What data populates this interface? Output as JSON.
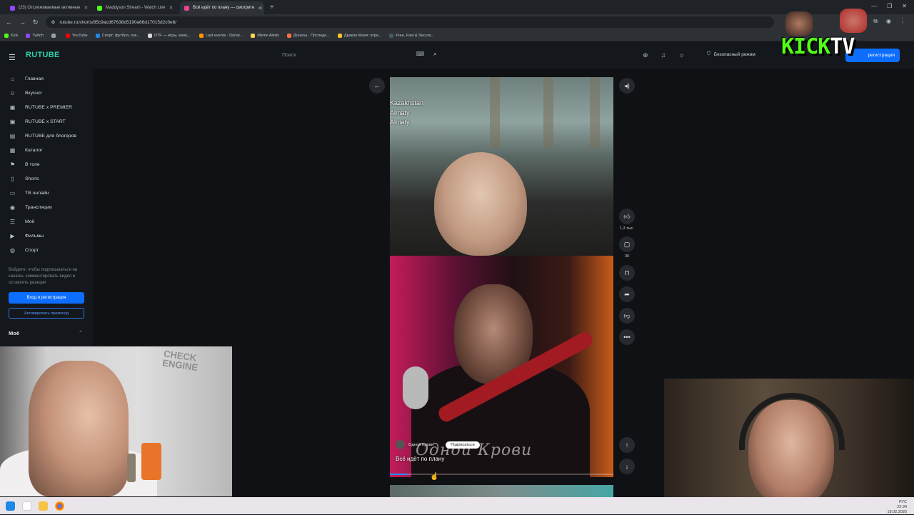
{
  "browser": {
    "tabs": [
      {
        "label": "(23) Отслеживаемые активные",
        "color": "#9146ff",
        "active": false
      },
      {
        "label": "Maddyson Stream - Watch Live",
        "color": "#53fc18",
        "active": false
      },
      {
        "label": "Всё идёт по плану — смотрите",
        "color": "#e84393",
        "active": true
      }
    ],
    "new_tab": "+",
    "address": "rutube.ru/shorts/85c9acd67638d5190a66d17015d2c0e8/",
    "bookmarks": [
      {
        "label": "Kick",
        "color": "#53fc18"
      },
      {
        "label": "Twitch",
        "color": "#9146ff"
      },
      {
        "label": "",
        "color": "#9aa0a6"
      },
      {
        "label": "YouTube",
        "color": "#ff0000"
      },
      {
        "label": "Спорт: футбол, хок...",
        "color": "#1e88e5"
      },
      {
        "label": "DTF — игры, кино,...",
        "color": "#d8d8d8"
      },
      {
        "label": "Last events · Donat...",
        "color": "#ff9800"
      },
      {
        "label": "Meme Alerts",
        "color": "#ffd54f"
      },
      {
        "label": "Донаты · Последн...",
        "color": "#ff7043"
      },
      {
        "label": "Дракон Маня: игра...",
        "color": "#fbc02d"
      },
      {
        "label": "Free, Fast & Secure...",
        "color": "#455a64"
      }
    ]
  },
  "rutube": {
    "logo": "RUTUBE",
    "search_placeholder": "Поиск",
    "safe_mode": "Безопасный режим",
    "login_button": "регистрация",
    "nav": [
      {
        "label": "Главная",
        "icon": "⌂"
      },
      {
        "label": "Вкусно!",
        "icon": "☺"
      },
      {
        "label": "RUTUBE x PREMIER",
        "icon": "▣"
      },
      {
        "label": "RUTUBE x START",
        "icon": "▣"
      },
      {
        "label": "RUTUBE для блогеров",
        "icon": "▤"
      },
      {
        "label": "Каталог",
        "icon": "▦"
      },
      {
        "label": "В топе",
        "icon": "⚑"
      },
      {
        "label": "Shorts",
        "icon": "▯"
      },
      {
        "label": "ТВ онлайн",
        "icon": "▭"
      },
      {
        "label": "Трансляции",
        "icon": "◉"
      },
      {
        "label": "Моё",
        "icon": "☰"
      },
      {
        "label": "Фильмы",
        "icon": "▶"
      },
      {
        "label": "Спорт",
        "icon": "◍"
      }
    ],
    "sidebar_hint": "Войдите, чтобы подписываться на каналы, комментировать видео и оставлять реакции",
    "sidebar_login": "Вход и регистрация",
    "sidebar_promo": "Активировать промокод",
    "sidebar_section": "Моё"
  },
  "video": {
    "location_lines": [
      "Kazakhstan",
      "Almaty",
      "Almaty"
    ],
    "channel_name": "Одной Крови",
    "subscribe_label": "Подписаться",
    "title": "Всё идёт по плану",
    "watermark": "Одной Крови",
    "progress": 0.08,
    "likes": "1,3 тыс.",
    "comments": "39"
  },
  "overlay": {
    "kick_text": "KICK",
    "tv_text": "TV",
    "wall_text": "CHECK ENGINE"
  },
  "taskbar": {
    "time": "22:34",
    "date": "19.02.2026",
    "lang": "РУС"
  }
}
